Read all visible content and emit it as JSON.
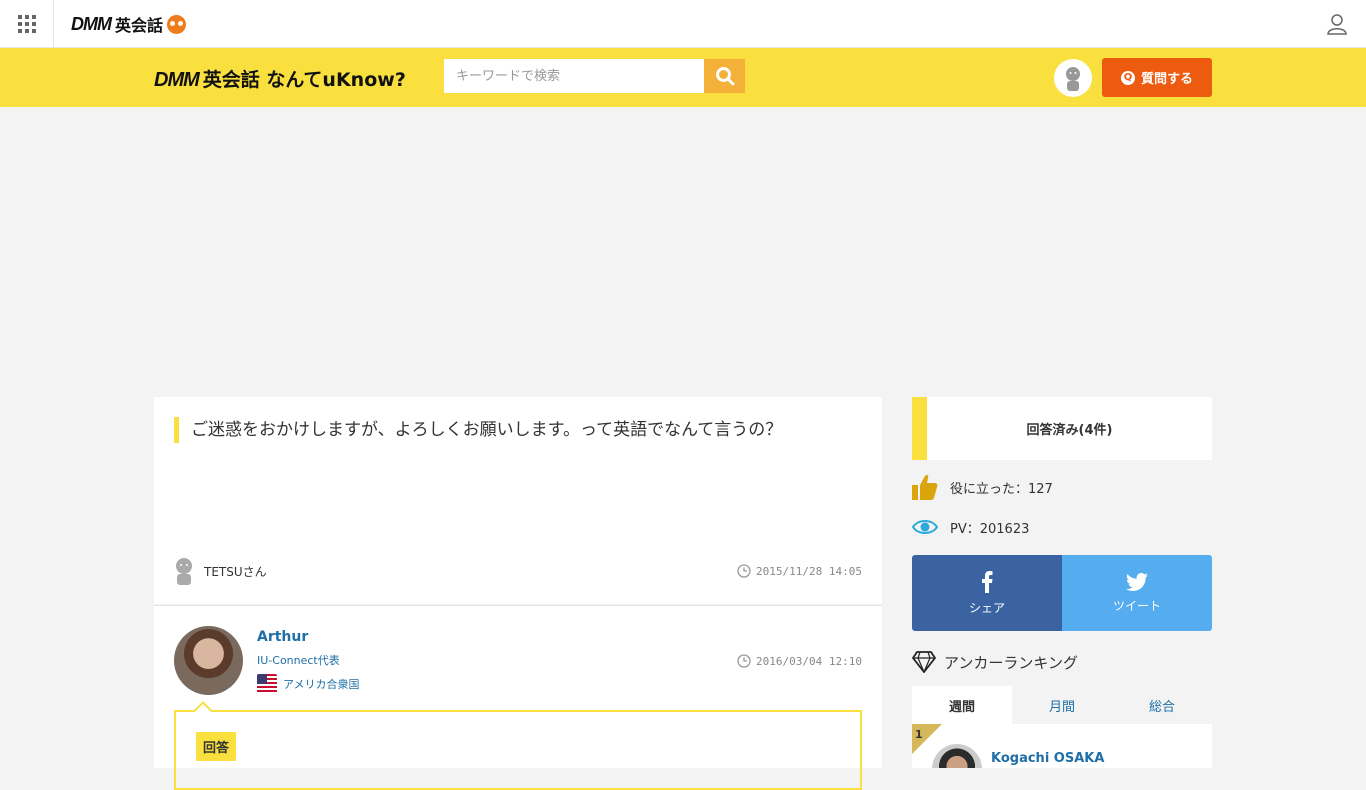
{
  "topbar": {
    "brand_dmm": "DMM",
    "brand_jp": "英会話"
  },
  "header": {
    "logo_dmm": "DMM",
    "logo_text": "英会話 なんてuKnow?",
    "search_placeholder": "キーワードで検索",
    "ask_label": "質問する",
    "ask_icon_text": "Q"
  },
  "question": {
    "title": "ご迷惑をおかけしますが、よろしくお願いします。って英語でなんて言うの？",
    "asker": "TETSUさん",
    "date": "2015/11/28 14:05"
  },
  "answer": {
    "name": "Arthur",
    "title": "IU-Connect代表",
    "country": "アメリカ合衆国",
    "date": "2016/03/04 12:10",
    "tag": "回答"
  },
  "sidebar": {
    "status": "回答済み(4件)",
    "helpful": "役に立った：127",
    "pv": "PV：201623",
    "share_facebook": "シェア",
    "share_twitter": "ツイート",
    "ranking_title": "アンカーランキング",
    "tabs": [
      "週間",
      "月間",
      "総合"
    ],
    "top_rank": {
      "number": "1",
      "name": "Kogachi OSAKA"
    }
  },
  "colors": {
    "yellow": "#f9e03f",
    "orange": "#ec5b0f",
    "link_blue": "#1e6fa7",
    "facebook": "#3b63a2",
    "twitter": "#55acee"
  }
}
